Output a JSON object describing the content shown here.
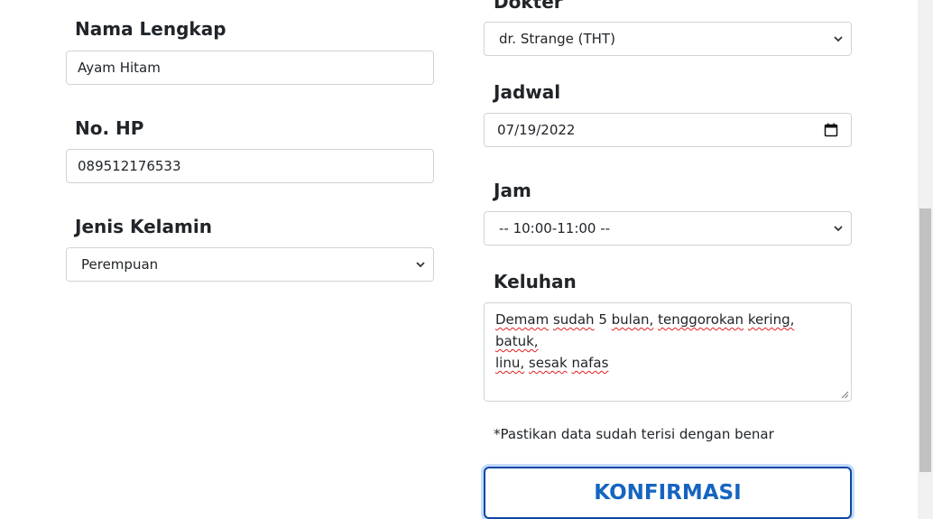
{
  "left": {
    "nama_label": "Nama Lengkap",
    "nama_value": "Ayam Hitam",
    "hp_label": "No. HP",
    "hp_value": "089512176533",
    "jk_label": "Jenis Kelamin",
    "jk_value": "Perempuan"
  },
  "right": {
    "dokter_label": "Dokter",
    "dokter_value": "dr. Strange (THT)",
    "jadwal_label": "Jadwal",
    "jadwal_value": "07/19/2022",
    "jam_label": "Jam",
    "jam_value": "-- 10:00-11:00 --",
    "keluhan_label": "Keluhan",
    "keluhan_words": [
      "Demam",
      "sudah",
      "5",
      "bulan,",
      "tenggorokan",
      "kering,",
      "batuk,",
      "linu,",
      "sesak",
      "nafas"
    ],
    "note": "*Pastikan data sudah terisi dengan benar",
    "confirm_label": "KONFIRMASI"
  },
  "icons": [
    "chevron-down-icon",
    "calendar-icon",
    "resize-grip-icon"
  ],
  "colors": {
    "button_text": "#1565c0",
    "button_border": "#0d47a1",
    "field_border": "#ced4da"
  }
}
